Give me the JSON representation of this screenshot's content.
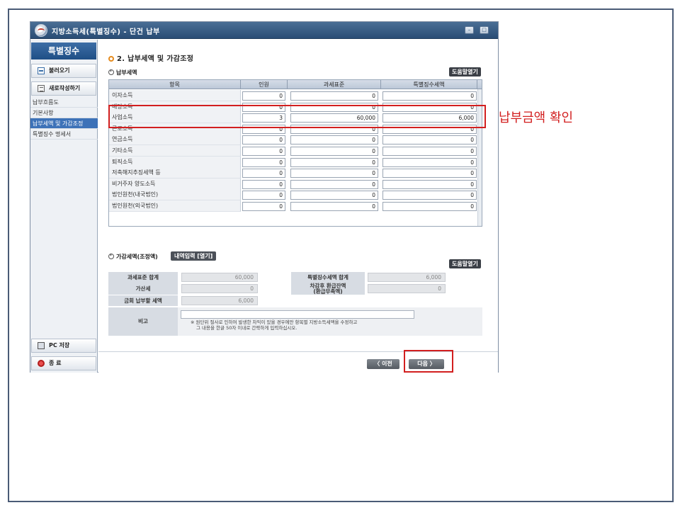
{
  "window": {
    "title": "지방소득세(특별징수) - 단건 납부",
    "min_btn": "–",
    "max_btn": "□"
  },
  "sidebar": {
    "header": "특별징수",
    "load_btn": "불러오기",
    "new_btn": "새로작성하기",
    "menu": [
      {
        "label": "납부흐름도",
        "active": false
      },
      {
        "label": "기본사항",
        "active": false
      },
      {
        "label": "납부세액 및 가감조정",
        "active": true
      },
      {
        "label": "특별징수 명세서",
        "active": false
      }
    ],
    "pc_save_btn": "PC 저장",
    "exit_btn": "종 료"
  },
  "main": {
    "section_title": "2. 납부세액 및 가감조정",
    "tax_subtitle": "납부세액",
    "help_btn": "도움말열기",
    "grid": {
      "headers": [
        "항목",
        "인원",
        "과세표준",
        "특별징수세액"
      ],
      "rows": [
        {
          "label": "이자소득",
          "count": "0",
          "base": "0",
          "tax": "0"
        },
        {
          "label": "배당소득",
          "count": "0",
          "base": "0",
          "tax": "0"
        },
        {
          "label": "사업소득",
          "count": "3",
          "base": "60,000",
          "tax": "6,000"
        },
        {
          "label": "근로소득",
          "count": "0",
          "base": "0",
          "tax": "0"
        },
        {
          "label": "연금소득",
          "count": "0",
          "base": "0",
          "tax": "0"
        },
        {
          "label": "기타소득",
          "count": "0",
          "base": "0",
          "tax": "0"
        },
        {
          "label": "퇴직소득",
          "count": "0",
          "base": "0",
          "tax": "0"
        },
        {
          "label": "저축해지추징세액 등",
          "count": "0",
          "base": "0",
          "tax": "0"
        },
        {
          "label": "비거주자 양도소득",
          "count": "0",
          "base": "0",
          "tax": "0"
        },
        {
          "label": "법인원천(내국법인)",
          "count": "0",
          "base": "0",
          "tax": "0"
        },
        {
          "label": "법인원천(외국법인)",
          "count": "0",
          "base": "0",
          "tax": "0"
        }
      ]
    },
    "adjust_subtitle": "가감세액(조정액)",
    "detail_btn": "내역입력 [열기]",
    "help_btn2": "도움말열기",
    "adjust": {
      "base_total_label": "과세표준 합계",
      "base_total_value": "60,000",
      "tax_total_label": "특별징수세액 합계",
      "tax_total_value": "6,000",
      "addition_label": "가산세",
      "addition_value": "0",
      "refund_label_1": "차감후 환급잔액",
      "refund_label_2": "(환급무족액)",
      "refund_value": "0",
      "payable_label": "금회 납부할 세액",
      "payable_value": "6,000",
      "remark_label": "비고",
      "remark_note_1": "※ 원단위 절사로 인하여 발생한 차익이 있을 경우에만 항목별 지방소득세액을 수정하고",
      "remark_note_2": "그 내용을 한글 50자 이내로 간략하게 입력하십시오."
    }
  },
  "nav": {
    "prev_btn": "〈 이전",
    "next_btn": "다음 〉"
  },
  "annotation": {
    "text": "납부금액 확인",
    "color": "#d21f1f"
  }
}
